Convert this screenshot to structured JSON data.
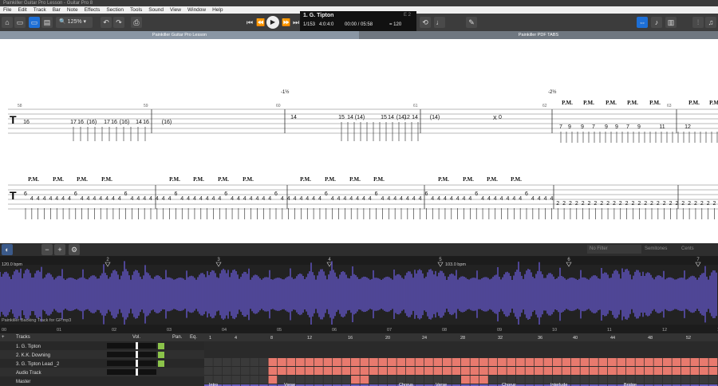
{
  "window": {
    "title": "Painkiller Guitar Pro Lesson - Guitar Pro 8"
  },
  "menu": [
    "File",
    "Edit",
    "Track",
    "Bar",
    "Note",
    "Effects",
    "Section",
    "Tools",
    "Sound",
    "View",
    "Window",
    "Help"
  ],
  "toolbar": {
    "zoom": "125%",
    "track_name": "1. G. Tipton",
    "bar_pos": "1/153",
    "sig": "4:0:4:0",
    "time": "00:00 / 05:58",
    "tempo": "= 120",
    "tuning": "E 2"
  },
  "tabs": [
    {
      "label": "Painkiller Guitar Pro Lesson",
      "active": true
    },
    {
      "label": "Painkiller PDF TABS",
      "active": false
    }
  ],
  "score": {
    "bars_row1": [
      "58",
      "59",
      "60",
      "61",
      "62",
      "63"
    ],
    "row1_notes": [
      "16",
      "17",
      "16",
      "(16)",
      "17",
      "16",
      "(16)",
      "14",
      "16",
      "(16)",
      "14",
      "15",
      "14",
      "(14)",
      "15",
      "14",
      "(14)",
      "12",
      "14",
      "(14)",
      "0",
      "7",
      "9",
      "9",
      "7",
      "9",
      "9",
      "7",
      "9",
      "11",
      "12"
    ],
    "bends": [
      "-1½",
      "-2½"
    ],
    "pm": "P.M.",
    "xmark": "X",
    "row2_notes": [
      "6",
      "4",
      "2"
    ]
  },
  "midbar": {
    "filter": "No Filter",
    "semitones": "Semitones",
    "cents": "Cents"
  },
  "audio": {
    "tempo1": "120.0 bpm",
    "tempo2": "103.0 bpm",
    "track": "Painkiller Backing Track for GP.mp3",
    "markers": [
      "2",
      "3",
      "4",
      "5",
      "6",
      "7"
    ],
    "timeline": [
      "00",
      "01",
      "02",
      "03",
      "04",
      "05",
      "06",
      "07",
      "08",
      "09",
      "10",
      "11",
      "12",
      "13"
    ]
  },
  "tracks": {
    "header": "Tracks",
    "vol": "Vol.",
    "pan": "Pan.",
    "eq": "Eq.",
    "items": [
      {
        "name": "1. G. Tipton"
      },
      {
        "name": "2. K.K. Downing"
      },
      {
        "name": "3. G. Tipton Lead _2"
      },
      {
        "name": "Audio Track"
      },
      {
        "name": "Master"
      }
    ],
    "ruler": [
      "1",
      "4",
      "8",
      "12",
      "16",
      "20",
      "24",
      "28",
      "32",
      "36",
      "40",
      "44",
      "48",
      "52"
    ],
    "sections": [
      "Intro",
      "Verse",
      "Chorus",
      "Verse",
      "Chorus",
      "Interlude",
      "Bridge"
    ],
    "colors": {
      "guitar": "#e87a6e",
      "audio": "#6b5fc2",
      "master": "#2a2a2a"
    }
  }
}
